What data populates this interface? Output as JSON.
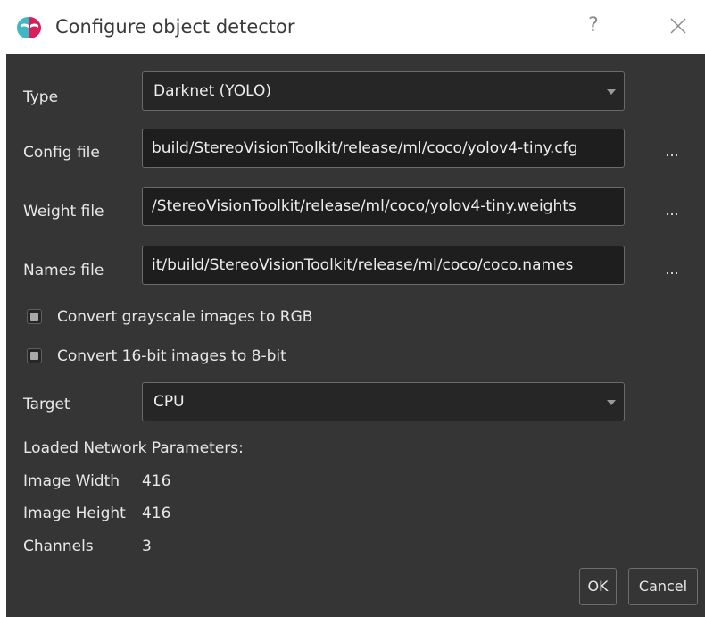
{
  "window": {
    "title": "Configure object detector",
    "help": "?",
    "close": "✕"
  },
  "form": {
    "type": {
      "label": "Type",
      "value": "Darknet (YOLO)"
    },
    "config": {
      "label": "Config file",
      "value": "build/StereoVisionToolkit/release/ml/coco/yolov4-tiny.cfg",
      "browse": "..."
    },
    "weights": {
      "label": "Weight file",
      "value": "/StereoVisionToolkit/release/ml/coco/yolov4-tiny.weights",
      "browse": "..."
    },
    "names": {
      "label": "Names file",
      "value": "it/build/StereoVisionToolkit/release/ml/coco/coco.names",
      "browse": "..."
    },
    "convert_gray": {
      "label": "Convert grayscale images to RGB",
      "checked": false
    },
    "convert_16bit": {
      "label": "Convert 16-bit images to 8-bit",
      "checked": false
    },
    "target": {
      "label": "Target",
      "value": "CPU"
    }
  },
  "params": {
    "heading": "Loaded Network Parameters:",
    "width_label": "Image Width",
    "width_value": "416",
    "height_label": "Image Height",
    "height_value": "416",
    "channels_label": "Channels",
    "channels_value": "3"
  },
  "buttons": {
    "ok": "OK",
    "cancel": "Cancel"
  }
}
